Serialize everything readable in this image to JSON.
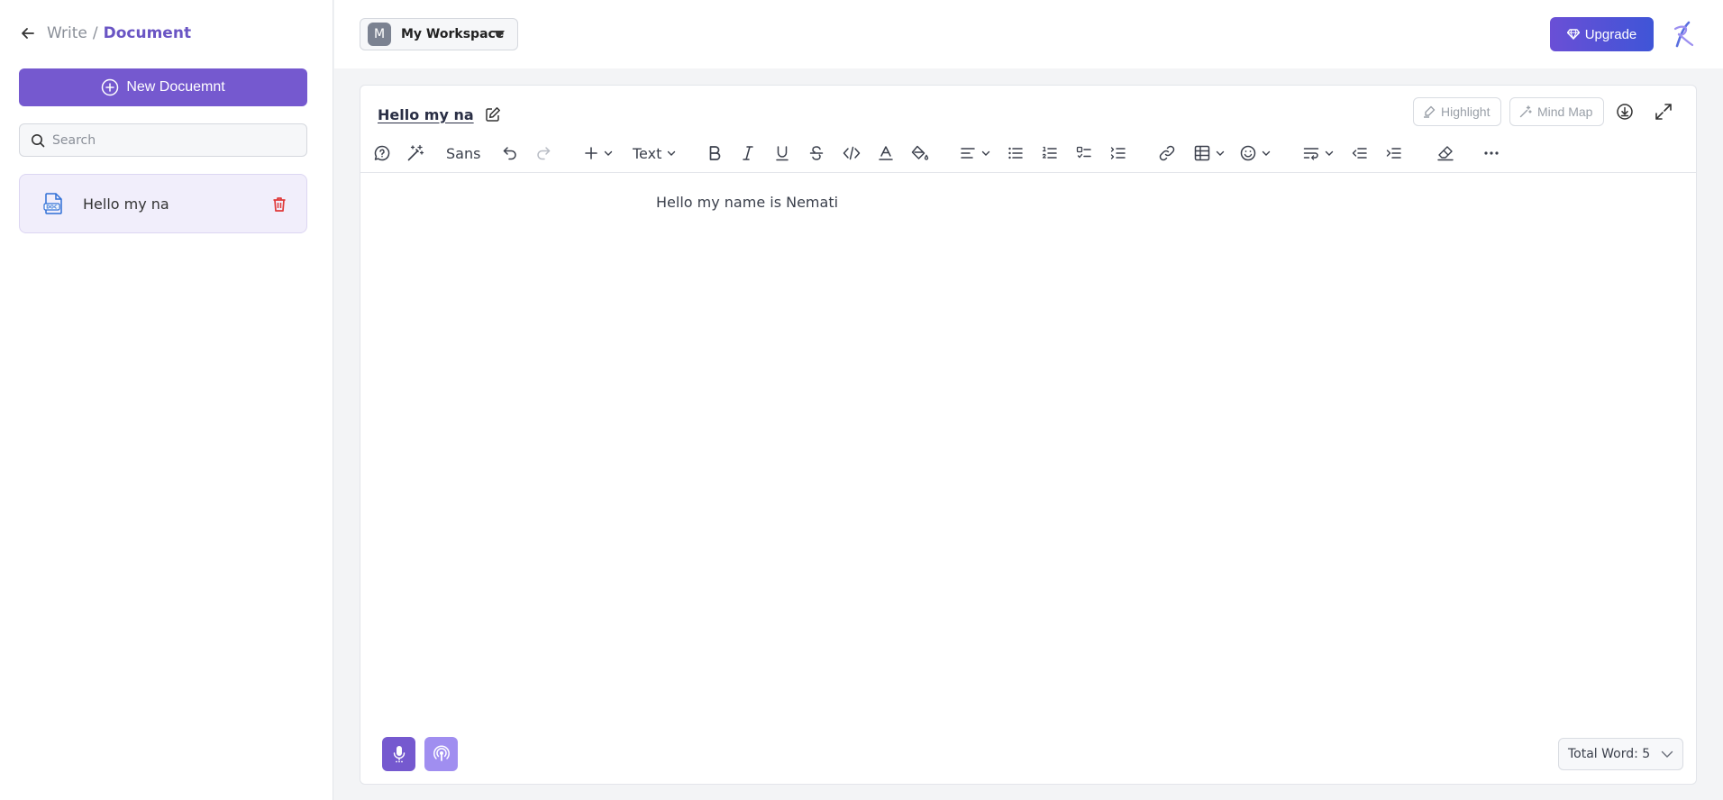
{
  "sidebar": {
    "breadcrumb": {
      "parent": "Write",
      "separator": "/",
      "current": "Document"
    },
    "new_document_label": "New Docuemnt",
    "search": {
      "placeholder": "Search",
      "value": ""
    },
    "documents": [
      {
        "label": "Hello my na",
        "icon": "doc-file-icon"
      }
    ]
  },
  "topbar": {
    "workspace": {
      "initial": "M",
      "name": "My Workspace"
    },
    "upgrade_label": "Upgrade"
  },
  "editor": {
    "title": "Hello my na",
    "highlight_label": "Highlight",
    "mindmap_label": "Mind Map",
    "toolbar": {
      "font_label": "Sans",
      "block_type_label": "Text"
    },
    "content": "Hello my name is Nemati",
    "word_count_label": "Total Word: 5"
  },
  "colors": {
    "accent": "#7559cf",
    "accent_light": "#a08ef0",
    "upgrade_start": "#6a4fd6",
    "upgrade_end": "#3f55d7",
    "delete": "#e03a3a"
  }
}
